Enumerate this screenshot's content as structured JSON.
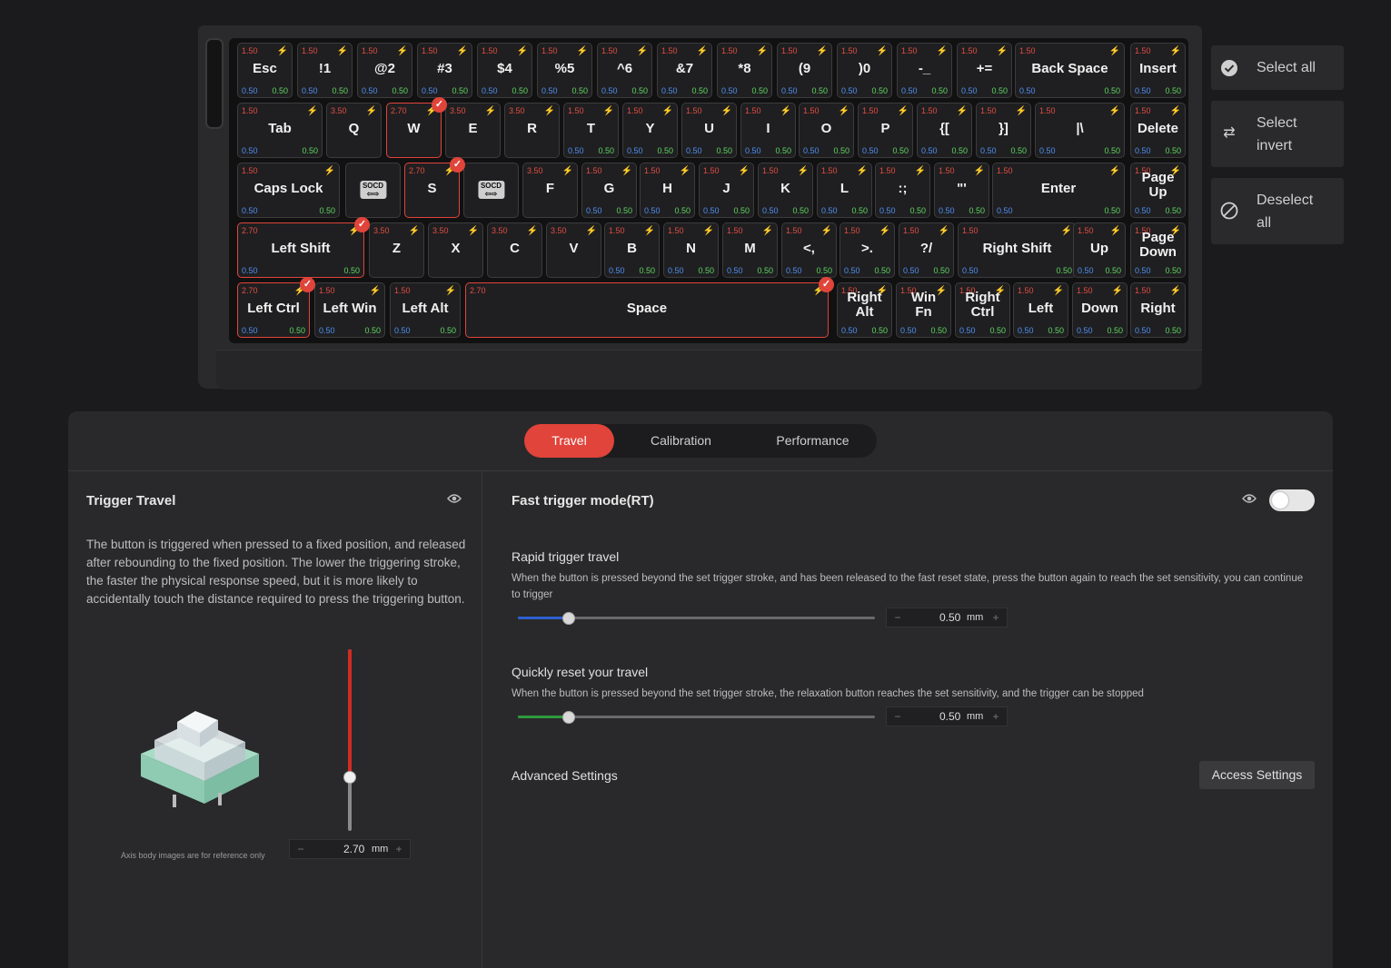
{
  "keyboard": {
    "rows": [
      [
        {
          "label": "Esc",
          "top": "1.50",
          "bl": "0.50",
          "br": "0.50"
        },
        {
          "label": "!1",
          "top": "1.50",
          "bl": "0.50",
          "br": "0.50"
        },
        {
          "label": "@2",
          "top": "1.50",
          "bl": "0.50",
          "br": "0.50"
        },
        {
          "label": "#3",
          "top": "1.50",
          "bl": "0.50",
          "br": "0.50"
        },
        {
          "label": "$4",
          "top": "1.50",
          "bl": "0.50",
          "br": "0.50"
        },
        {
          "label": "%5",
          "top": "1.50",
          "bl": "0.50",
          "br": "0.50"
        },
        {
          "label": "^6",
          "top": "1.50",
          "bl": "0.50",
          "br": "0.50"
        },
        {
          "label": "&7",
          "top": "1.50",
          "bl": "0.50",
          "br": "0.50"
        },
        {
          "label": "*8",
          "top": "1.50",
          "bl": "0.50",
          "br": "0.50"
        },
        {
          "label": "(9",
          "top": "1.50",
          "bl": "0.50",
          "br": "0.50"
        },
        {
          "label": ")0",
          "top": "1.50",
          "bl": "0.50",
          "br": "0.50"
        },
        {
          "label": "-_",
          "top": "1.50",
          "bl": "0.50",
          "br": "0.50"
        },
        {
          "label": "+=",
          "top": "1.50",
          "bl": "0.50",
          "br": "0.50"
        },
        {
          "label": "Back Space",
          "top": "1.50",
          "bl": "0.50",
          "br": "0.50"
        },
        {
          "label": "Insert",
          "top": "1.50",
          "bl": "0.50",
          "br": "0.50"
        }
      ],
      [
        {
          "label": "Tab",
          "top": "1.50",
          "bl": "0.50",
          "br": "0.50"
        },
        {
          "label": "Q",
          "top": "3.50"
        },
        {
          "label": "W",
          "top": "2.70",
          "selected": true
        },
        {
          "label": "E",
          "top": "3.50"
        },
        {
          "label": "R",
          "top": "3.50"
        },
        {
          "label": "T",
          "top": "1.50",
          "bl": "0.50",
          "br": "0.50"
        },
        {
          "label": "Y",
          "top": "1.50",
          "bl": "0.50",
          "br": "0.50"
        },
        {
          "label": "U",
          "top": "1.50",
          "bl": "0.50",
          "br": "0.50"
        },
        {
          "label": "I",
          "top": "1.50",
          "bl": "0.50",
          "br": "0.50"
        },
        {
          "label": "O",
          "top": "1.50",
          "bl": "0.50",
          "br": "0.50"
        },
        {
          "label": "P",
          "top": "1.50",
          "bl": "0.50",
          "br": "0.50"
        },
        {
          "label": "{[",
          "top": "1.50",
          "bl": "0.50",
          "br": "0.50"
        },
        {
          "label": "}]",
          "top": "1.50",
          "bl": "0.50",
          "br": "0.50"
        },
        {
          "label": "|\\",
          "top": "1.50",
          "bl": "0.50",
          "br": "0.50"
        },
        {
          "label": "Delete",
          "top": "1.50",
          "bl": "0.50",
          "br": "0.50"
        }
      ],
      [
        {
          "label": "Caps Lock",
          "top": "1.50",
          "bl": "0.50",
          "br": "0.50"
        },
        {
          "label": "",
          "socd": "SOCD\n⇦⇨"
        },
        {
          "label": "S",
          "top": "2.70",
          "selected": true
        },
        {
          "label": "",
          "socd": "SOCD\n⇦⇨"
        },
        {
          "label": "F",
          "top": "3.50"
        },
        {
          "label": "G",
          "top": "1.50",
          "bl": "0.50",
          "br": "0.50"
        },
        {
          "label": "H",
          "top": "1.50",
          "bl": "0.50",
          "br": "0.50"
        },
        {
          "label": "J",
          "top": "1.50",
          "bl": "0.50",
          "br": "0.50"
        },
        {
          "label": "K",
          "top": "1.50",
          "bl": "0.50",
          "br": "0.50"
        },
        {
          "label": "L",
          "top": "1.50",
          "bl": "0.50",
          "br": "0.50"
        },
        {
          "label": ":;",
          "top": "1.50",
          "bl": "0.50",
          "br": "0.50"
        },
        {
          "label": "\"'",
          "top": "1.50",
          "bl": "0.50",
          "br": "0.50"
        },
        {
          "label": "Enter",
          "top": "1.50",
          "bl": "0.50",
          "br": "0.50"
        },
        {
          "label": "Page\nUp",
          "top": "1.50",
          "bl": "0.50",
          "br": "0.50"
        }
      ],
      [
        {
          "label": "Left Shift",
          "top": "2.70",
          "bl": "0.50",
          "br": "0.50",
          "selected": true
        },
        {
          "label": "Z",
          "top": "3.50"
        },
        {
          "label": "X",
          "top": "3.50"
        },
        {
          "label": "C",
          "top": "3.50"
        },
        {
          "label": "V",
          "top": "3.50"
        },
        {
          "label": "B",
          "top": "1.50",
          "bl": "0.50",
          "br": "0.50"
        },
        {
          "label": "N",
          "top": "1.50",
          "bl": "0.50",
          "br": "0.50"
        },
        {
          "label": "M",
          "top": "1.50",
          "bl": "0.50",
          "br": "0.50"
        },
        {
          "label": "<,",
          "top": "1.50",
          "bl": "0.50",
          "br": "0.50"
        },
        {
          "label": ">.",
          "top": "1.50",
          "bl": "0.50",
          "br": "0.50"
        },
        {
          "label": "?/",
          "top": "1.50",
          "bl": "0.50",
          "br": "0.50"
        },
        {
          "label": "Right Shift",
          "top": "1.50",
          "bl": "0.50",
          "br": "0.50"
        },
        {
          "label": "Up",
          "top": "1.50",
          "bl": "0.50",
          "br": "0.50"
        },
        {
          "label": "Page\nDown",
          "top": "1.50",
          "bl": "0.50",
          "br": "0.50"
        }
      ],
      [
        {
          "label": "Left Ctrl",
          "top": "2.70",
          "bl": "0.50",
          "br": "0.50",
          "selected": true
        },
        {
          "label": "Left Win",
          "top": "1.50",
          "bl": "0.50",
          "br": "0.50"
        },
        {
          "label": "Left Alt",
          "top": "1.50",
          "bl": "0.50",
          "br": "0.50"
        },
        {
          "label": "Space",
          "top": "2.70",
          "selected": true
        },
        {
          "label": "Right\nAlt",
          "top": "1.50",
          "bl": "0.50",
          "br": "0.50"
        },
        {
          "label": "Win\nFn",
          "top": "1.50",
          "bl": "0.50",
          "br": "0.50"
        },
        {
          "label": "Right\nCtrl",
          "top": "1.50",
          "bl": "0.50",
          "br": "0.50"
        },
        {
          "label": "Left",
          "top": "1.50",
          "bl": "0.50",
          "br": "0.50"
        },
        {
          "label": "Down",
          "top": "1.50",
          "bl": "0.50",
          "br": "0.50"
        },
        {
          "label": "Right",
          "top": "1.50",
          "bl": "0.50",
          "br": "0.50"
        }
      ]
    ]
  },
  "selection_panel": {
    "select_all": "Select all",
    "select_invert": "Select\ninvert",
    "deselect_all": "Deselect\nall"
  },
  "tabs": {
    "travel": "Travel",
    "calibration": "Calibration",
    "performance": "Performance",
    "active": "travel"
  },
  "trigger_travel": {
    "title": "Trigger Travel",
    "description": "The button is triggered when pressed to a fixed position, and released after rebounding to the fixed position. The lower the triggering stroke, the faster the physical response speed, but it is more likely to accidentally touch the distance required to press the triggering button.",
    "image_note": "Axis body images are for reference only",
    "value": "2.70",
    "unit": "mm",
    "slider_fraction": 0.7
  },
  "fast_trigger": {
    "title": "Fast trigger mode(RT)",
    "enabled": false,
    "rapid": {
      "title": "Rapid trigger travel",
      "description": "When the button is pressed beyond the set trigger stroke, and has been released to the fast reset state, press the button again to reach the set sensitivity, you can continue to trigger",
      "value": "0.50",
      "unit": "mm",
      "slider_fraction": 0.14,
      "color": "#2f5fd0"
    },
    "reset": {
      "title": "Quickly reset your travel",
      "description": "When the button is pressed beyond the set trigger stroke, the relaxation button reaches the set sensitivity, and the trigger can be stopped",
      "value": "0.50",
      "unit": "mm",
      "slider_fraction": 0.14,
      "color": "#2e9a3e"
    },
    "advanced_label": "Advanced Settings",
    "access_button": "Access Settings"
  },
  "colors": {
    "accent": "#e0443a",
    "top_value": "#e24d42",
    "bottom_left_value": "#4f8ff0",
    "bottom_right_value": "#5fd45f"
  }
}
